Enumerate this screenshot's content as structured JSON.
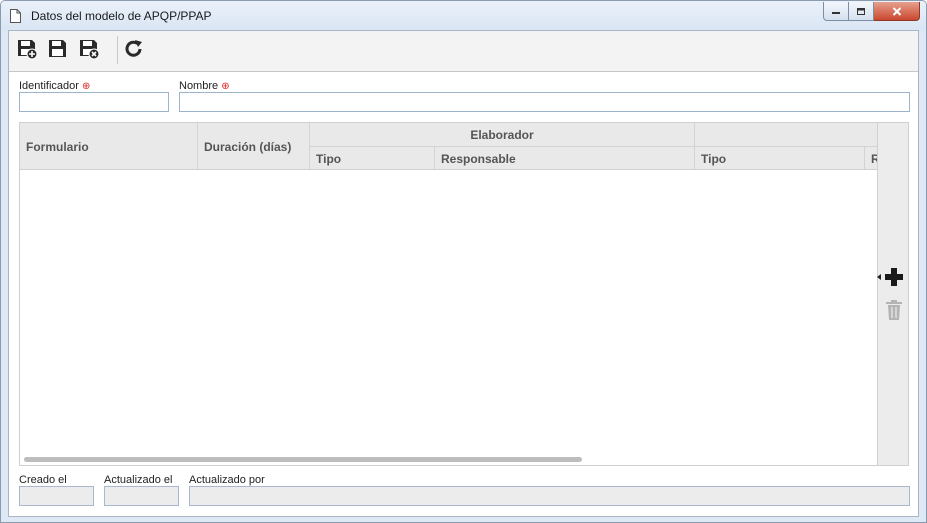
{
  "window": {
    "title": "Datos del modelo de APQP/PPAP"
  },
  "toolbar": {
    "buttons": [
      {
        "name": "save-new-button",
        "icon": "floppy-plus-icon"
      },
      {
        "name": "save-button",
        "icon": "floppy-icon"
      },
      {
        "name": "save-close-button",
        "icon": "floppy-close-icon"
      },
      {
        "name": "refresh-button",
        "icon": "refresh-icon"
      }
    ]
  },
  "form": {
    "identificador_label": "Identificador",
    "identificador_value": "",
    "nombre_label": "Nombre",
    "nombre_value": ""
  },
  "grid": {
    "group_header": "Elaborador",
    "columns": {
      "formulario": "Formulario",
      "duracion": "Duración (días)",
      "tipo": "Tipo",
      "responsable": "Responsable",
      "tipo2": "Tipo",
      "truncated": "R"
    },
    "rows": []
  },
  "footer": {
    "creado_label": "Creado el",
    "creado_value": "",
    "actualizado_label": "Actualizado el",
    "actualizado_value": "",
    "actualizado_por_label": "Actualizado por",
    "actualizado_por_value": ""
  },
  "colors": {
    "accent_red": "#d22222",
    "header_bg": "#e9e9e9",
    "input_border": "#9db3cc"
  }
}
